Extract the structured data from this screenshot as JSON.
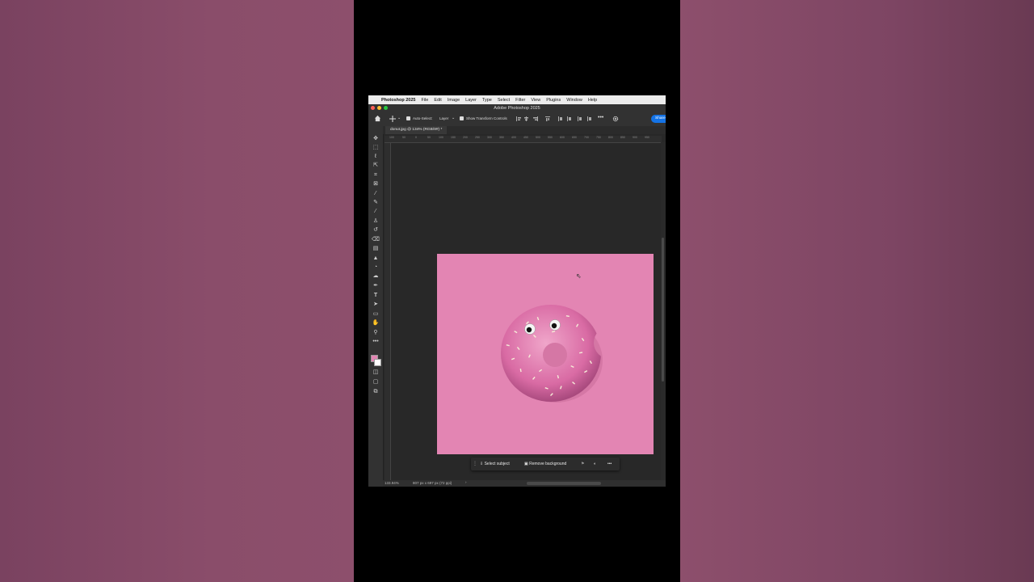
{
  "menubar": {
    "app_name": "Photoshop 2025",
    "items": [
      "File",
      "Edit",
      "Image",
      "Layer",
      "Type",
      "Select",
      "Filter",
      "View",
      "Plugins",
      "Window",
      "Help"
    ]
  },
  "window": {
    "title": "Adobe Photoshop 2025"
  },
  "options_bar": {
    "auto_select_label": "Auto-Select:",
    "auto_select_value": "Layer",
    "show_transform_label": "Show Transform Controls",
    "share_label": "Share"
  },
  "document": {
    "tab_label": "donut.jpg @ 134% (RGB/8#) *"
  },
  "ruler_ticks": [
    "100",
    "50",
    "0",
    "50",
    "100",
    "150",
    "200",
    "250",
    "300",
    "350",
    "400",
    "450",
    "500",
    "550",
    "600",
    "650",
    "700",
    "750",
    "800",
    "850",
    "900",
    "950"
  ],
  "status": {
    "zoom": "133.94%",
    "info": "807 px x 697 px (72 ppi)"
  },
  "contextual_bar": {
    "select_subject": "Select subject",
    "remove_background": "Remove background"
  },
  "colors": {
    "background_pink": "#e385b3",
    "donut_pink": "#d96ba4",
    "share_blue": "#1473e6",
    "foreground_swatch": "#e385b3",
    "background_swatch": "#ffffff"
  },
  "tools": [
    "move-icon",
    "marquee-icon",
    "lasso-icon",
    "object-select-icon",
    "crop-icon",
    "frame-icon",
    "eyedropper-icon",
    "healing-brush-icon",
    "brush-icon",
    "clone-stamp-icon",
    "history-brush-icon",
    "eraser-icon",
    "gradient-icon",
    "blur-icon",
    "dodge-icon",
    "sponge-icon",
    "pen-icon",
    "type-icon",
    "path-select-icon",
    "rectangle-icon",
    "hand-icon",
    "zoom-icon",
    "more-tools-icon"
  ]
}
